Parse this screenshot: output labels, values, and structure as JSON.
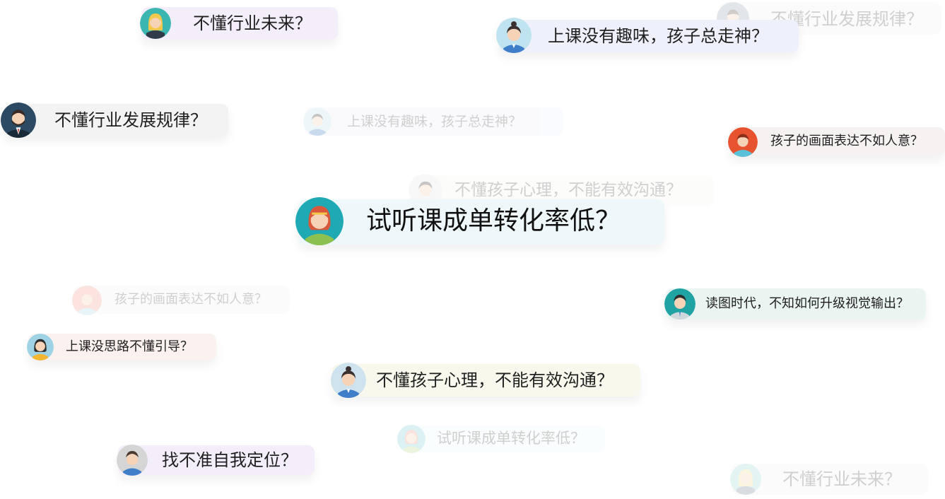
{
  "bubbles": [
    {
      "id": "b1",
      "text": "不懂行业未来？",
      "avatar": "blonde-woman-avatar",
      "bg": "#f4eefb",
      "faded": false
    },
    {
      "id": "b2",
      "text": "不懂行业发展规律？",
      "avatar": "man-avatar",
      "bg": "#f3f3f3",
      "faded": true
    },
    {
      "id": "b3",
      "text": "上课没有趣味，孩子总走神？",
      "avatar": "woman-teal-avatar",
      "bg": "#eef0fb",
      "faded": false
    },
    {
      "id": "b4",
      "text": "不懂行业发展规律？",
      "avatar": "bearded-man-avatar",
      "bg": "#f3f3f3",
      "faded": false
    },
    {
      "id": "b5",
      "text": "上课没有趣味，孩子总走神？",
      "avatar": "woman-teal-avatar",
      "bg": "#eef0fb",
      "faded": true
    },
    {
      "id": "b6",
      "text": "孩子的画面表达不如人意？",
      "avatar": "red-boy-avatar",
      "bg": "#f6f2f2",
      "faded": false
    },
    {
      "id": "b7",
      "text": "不懂孩子心理，不能有效沟通？",
      "avatar": "woman-avatar",
      "bg": "#f7f7ee",
      "faded": true
    },
    {
      "id": "b8",
      "text": "试听课成单转化率低？",
      "avatar": "redhair-girl-avatar",
      "bg": "#eef8fb",
      "faded": false
    },
    {
      "id": "b9",
      "text": "孩子的画面表达不如人意？",
      "avatar": "red-boy-avatar",
      "bg": "#f6f2f2",
      "faded": true
    },
    {
      "id": "b10",
      "text": "读图时代，不知如何升级视觉输出？",
      "avatar": "teal-man-avatar",
      "bg": "#eaf5f2",
      "faded": false
    },
    {
      "id": "b11",
      "text": "上课没思路不懂引导？",
      "avatar": "yellow-woman-avatar",
      "bg": "#fbf2ef",
      "faded": false
    },
    {
      "id": "b12",
      "text": "不懂孩子心理，不能有效沟通？",
      "avatar": "woman-avatar",
      "bg": "#f8f9ec",
      "faded": false
    },
    {
      "id": "b13",
      "text": "试听课成单转化率低？",
      "avatar": "redhair-girl-avatar",
      "bg": "#eef8fb",
      "faded": true
    },
    {
      "id": "b14",
      "text": "找不准自我定位？",
      "avatar": "grey-boy-avatar",
      "bg": "#f4eefb",
      "faded": false
    },
    {
      "id": "b15",
      "text": "不懂行业未来？",
      "avatar": "blonde-woman-avatar",
      "bg": "#f3f3f3",
      "faded": true
    }
  ],
  "colors": {
    "skin": "#f6d2b6",
    "dark_hair": "#3a3030",
    "teal": "#2fb3b3",
    "blue": "#3f7ec9"
  }
}
